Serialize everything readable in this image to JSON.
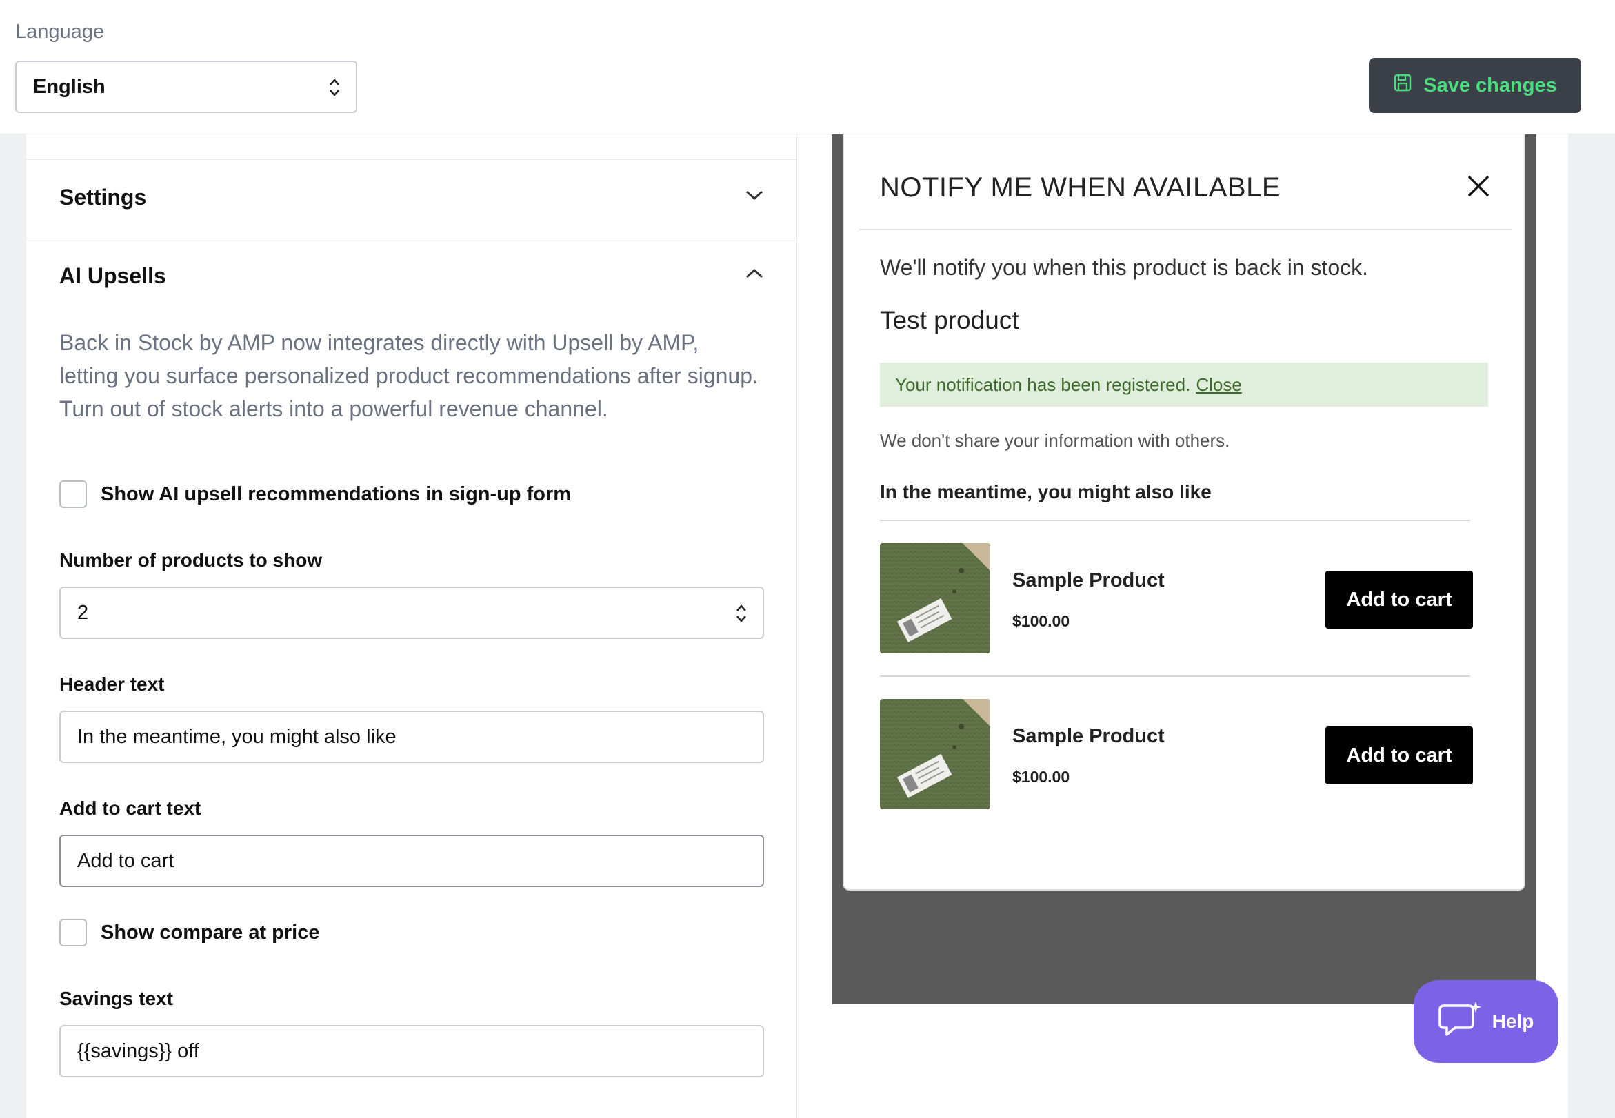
{
  "header": {
    "language_label": "Language",
    "language_value": "English",
    "save_label": "Save changes",
    "save_color": "#4ade80"
  },
  "settings": {
    "title": "Settings"
  },
  "ai_upsells": {
    "title": "AI Upsells",
    "description": "Back in Stock by AMP now integrates directly with Upsell by AMP, letting you surface personalized product recommendations after signup. Turn out of stock alerts into a powerful revenue channel.",
    "show_recommendations_label": "Show AI upsell recommendations in sign-up form",
    "show_recommendations_checked": false,
    "num_products_label": "Number of products to show",
    "num_products_value": "2",
    "header_text_label": "Header text",
    "header_text_value": "In the meantime, you might also like",
    "add_to_cart_label": "Add to cart text",
    "add_to_cart_value": "Add to cart",
    "compare_price_label": "Show compare at price",
    "compare_price_checked": false,
    "savings_label": "Savings text",
    "savings_value": "{{savings}} off"
  },
  "preview": {
    "title": "NOTIFY ME WHEN AVAILABLE",
    "message": "We'll notify you when this product is back in stock.",
    "product_name": "Test product",
    "success_text": "Your notification has been registered.",
    "success_link": "Close",
    "privacy_text": "We don't share your information with others.",
    "upsell_header": "In the meantime, you might also like",
    "products": [
      {
        "name": "Sample Product",
        "price": "$100.00",
        "button": "Add to cart"
      },
      {
        "name": "Sample Product",
        "price": "$100.00",
        "button": "Add to cart"
      }
    ]
  },
  "help": {
    "label": "Help",
    "color": "#7c62e6"
  }
}
